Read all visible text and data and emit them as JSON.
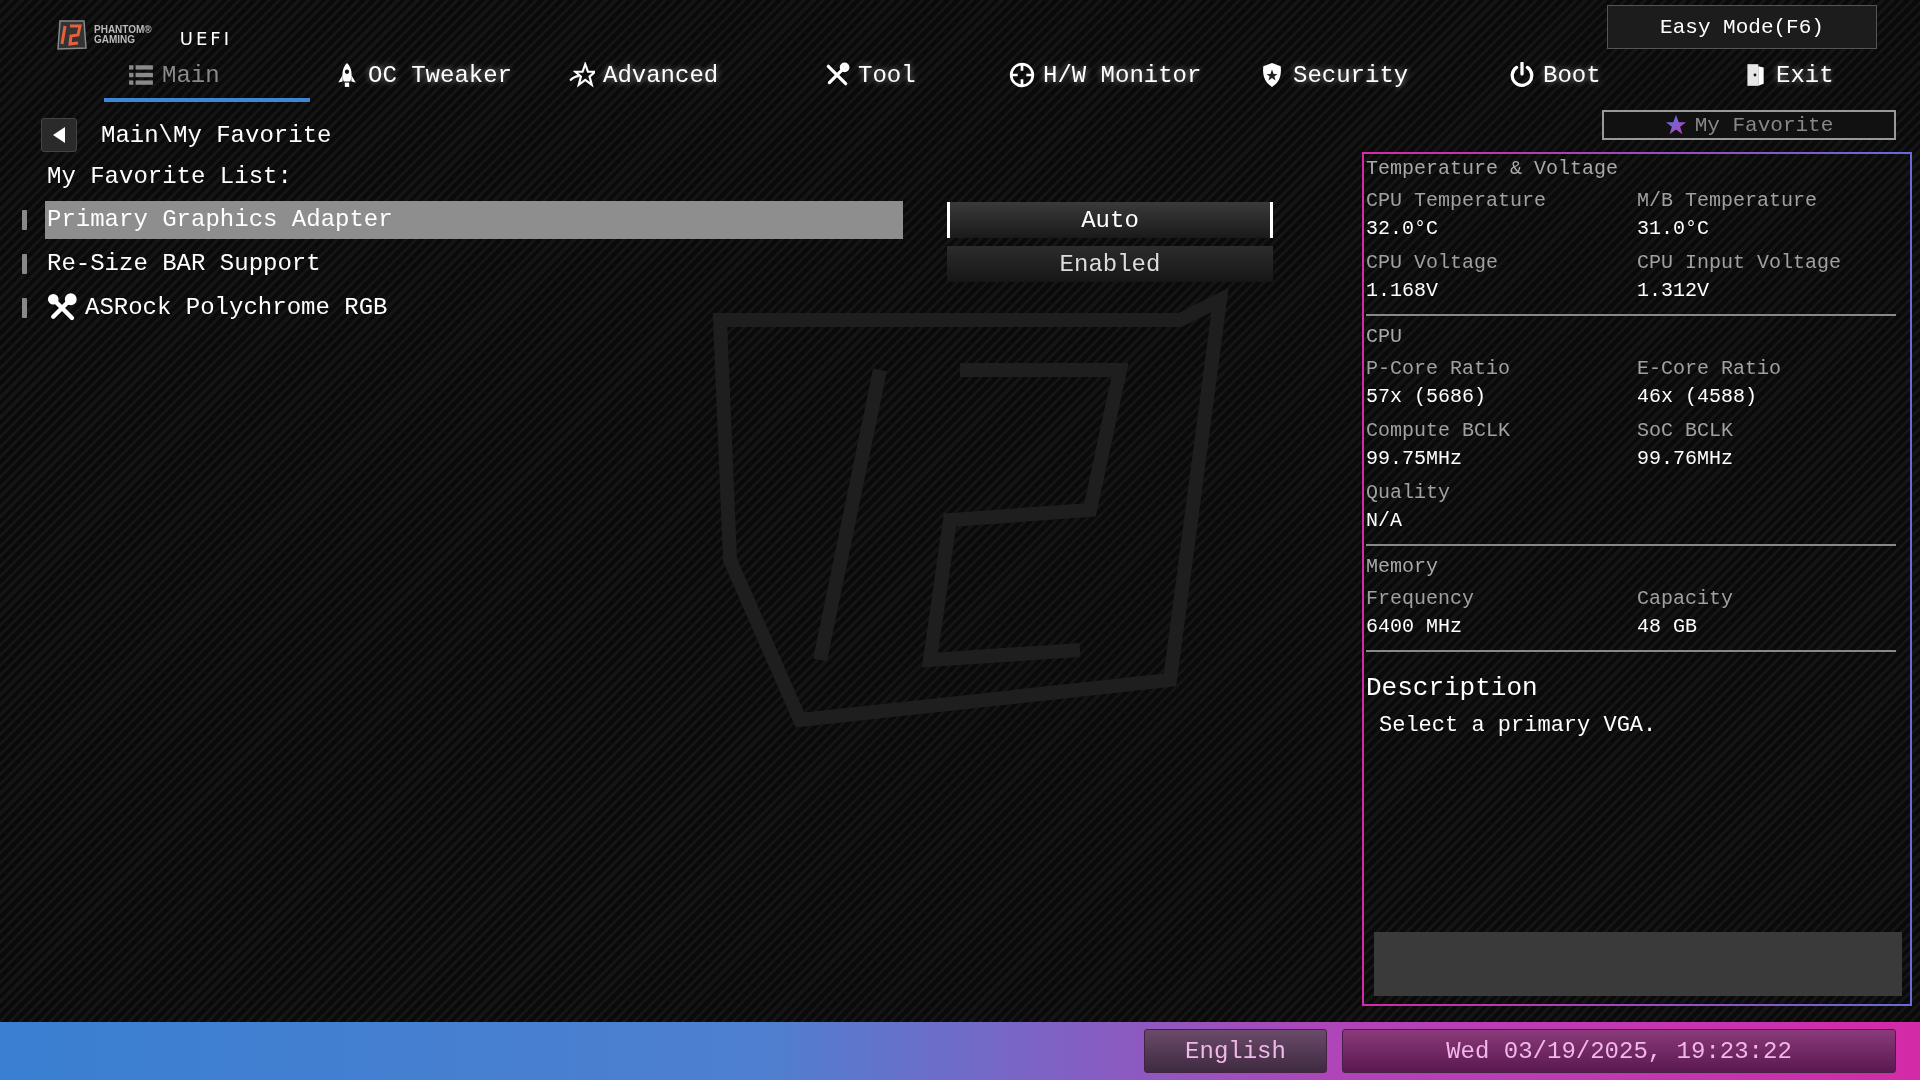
{
  "header": {
    "brand_lines": [
      "PHANTOM®",
      "GAMING"
    ],
    "product": "UEFI",
    "easy_mode_button": "Easy Mode(F6)"
  },
  "tabs": [
    {
      "label": "Main",
      "kind": "list",
      "selected": true
    },
    {
      "label": "OC Tweaker",
      "kind": "rocket",
      "selected": false
    },
    {
      "label": "Advanced",
      "kind": "star",
      "selected": false
    },
    {
      "label": "Tool",
      "kind": "tools",
      "selected": false
    },
    {
      "label": "H/W Monitor",
      "kind": "crosshair",
      "selected": false
    },
    {
      "label": "Security",
      "kind": "badge",
      "selected": false
    },
    {
      "label": "Boot",
      "kind": "power",
      "selected": false
    },
    {
      "label": "Exit",
      "kind": "door",
      "selected": false
    }
  ],
  "breadcrumb": "Main\\My Favorite",
  "my_favorite_button": "My Favorite",
  "list_title": "My Favorite List:",
  "items": [
    {
      "kind": "setting",
      "label": "Primary Graphics Adapter",
      "value": "Auto",
      "selected": true
    },
    {
      "kind": "setting",
      "label": "Re-Size BAR Support",
      "value": "Enabled",
      "selected": false
    },
    {
      "kind": "tool",
      "label": "ASRock Polychrome RGB",
      "selected": false
    }
  ],
  "monitor": {
    "sections": [
      {
        "title": "Temperature & Voltage",
        "fields": [
          {
            "label": "CPU Temperature",
            "value": "32.0°C"
          },
          {
            "label": "M/B Temperature",
            "value": "31.0°C"
          },
          {
            "label": "CPU Voltage",
            "value": "1.168V"
          },
          {
            "label": "CPU Input Voltage",
            "value": "1.312V"
          }
        ]
      },
      {
        "title": "CPU",
        "fields": [
          {
            "label": "P-Core Ratio",
            "value": "57x (5686)"
          },
          {
            "label": "E-Core Ratio",
            "value": "46x (4588)"
          },
          {
            "label": "Compute BCLK",
            "value": "99.75MHz"
          },
          {
            "label": "SoC BCLK",
            "value": "99.76MHz"
          },
          {
            "label": "Quality",
            "value": "N/A"
          }
        ]
      },
      {
        "title": "Memory",
        "fields": [
          {
            "label": "Frequency",
            "value": "6400 MHz"
          },
          {
            "label": "Capacity",
            "value": "48 GB"
          }
        ]
      }
    ]
  },
  "description": {
    "title": "Description",
    "text": "Select a primary VGA."
  },
  "status_bar": {
    "language": "English",
    "datetime": "Wed 03/19/2025, 19:23:22"
  }
}
